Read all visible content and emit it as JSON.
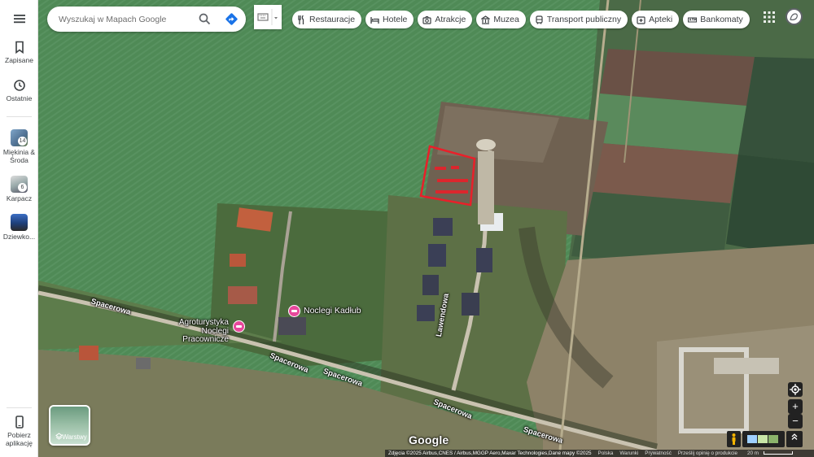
{
  "rail": {
    "menu_icon": "hamburger-menu-icon",
    "saved": {
      "label": "Zapisane",
      "icon": "bookmark-icon"
    },
    "recent": {
      "label": "Ostatnie",
      "icon": "history-icon"
    },
    "recent_places": [
      {
        "label": "Miękinia & Środa",
        "count": "14"
      },
      {
        "label": "Karpacz",
        "count": "6"
      },
      {
        "label": "Dziewko...",
        "count": ""
      }
    ],
    "get_app": {
      "label": "Pobierz aplikację",
      "icon": "phone-icon"
    }
  },
  "search": {
    "placeholder": "Wyszukaj w Mapach Google",
    "icon": "search-icon",
    "directions_icon": "directions-icon"
  },
  "chips": [
    {
      "label": "Restauracje",
      "icon": "restaurant-icon"
    },
    {
      "label": "Hotele",
      "icon": "hotel-icon"
    },
    {
      "label": "Atrakcje",
      "icon": "camera-icon"
    },
    {
      "label": "Muzea",
      "icon": "museum-icon"
    },
    {
      "label": "Transport publiczny",
      "icon": "transit-icon"
    },
    {
      "label": "Apteki",
      "icon": "pharmacy-icon"
    },
    {
      "label": "Bankomaty",
      "icon": "atm-icon"
    }
  ],
  "map": {
    "streets": [
      {
        "name": "Spacerowa"
      },
      {
        "name": "Spacerowa"
      },
      {
        "name": "Spacerowa"
      },
      {
        "name": "Spacerowa"
      },
      {
        "name": "Spacerowa"
      },
      {
        "name": "Lawendowa"
      }
    ],
    "pois": [
      {
        "name": "Noclegi Kadłub"
      },
      {
        "name": "Agroturystyka Noclegi Pracownicze"
      }
    ],
    "parcel_color": "#e8202a"
  },
  "layers": {
    "label": "Warstwy"
  },
  "brand": "Google",
  "footer": {
    "attribution": "Zdjęcia ©2025 Airbus,CNES / Airbus,MGGP Aero,Maxar Technologies,Dane mapy ©2025",
    "links": [
      "Polska",
      "Warunki",
      "Prywatność",
      "Prześlij opinię o produkcie"
    ],
    "scale": "20 m"
  },
  "controls": {
    "locate_icon": "my-location-icon",
    "zoom_in": "+",
    "zoom_out": "−"
  }
}
